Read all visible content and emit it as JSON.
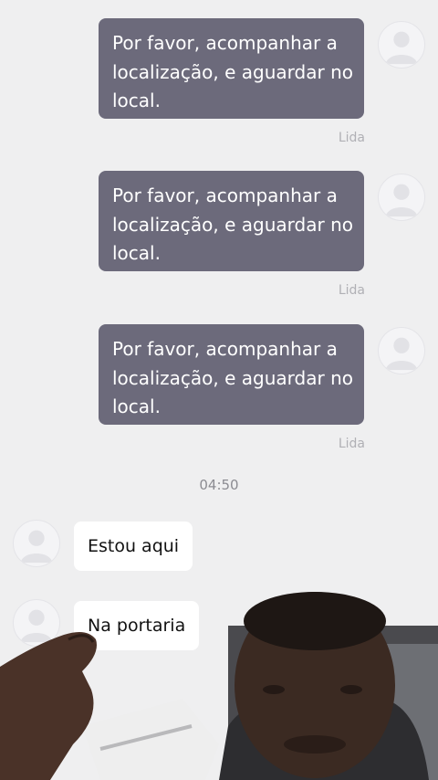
{
  "outgoing_messages": [
    {
      "text": "Por favor, acompanhar a localização, e aguardar no local.",
      "status": "Lida"
    },
    {
      "text": "Por favor, acompanhar a localização, e aguardar no local.",
      "status": "Lida"
    },
    {
      "text": "Por favor, acompanhar a localização, e aguardar no local.",
      "status": "Lida"
    }
  ],
  "time_separator": "04:50",
  "incoming_messages": [
    {
      "text": "Estou aqui"
    },
    {
      "text": "Na portaria"
    }
  ],
  "colors": {
    "background": "#efeff0",
    "outgoing_bubble": "#6c6a7b",
    "incoming_bubble": "#ffffff",
    "status_text": "#b0b0b5"
  },
  "icons": {
    "avatar": "user-avatar-icon"
  }
}
